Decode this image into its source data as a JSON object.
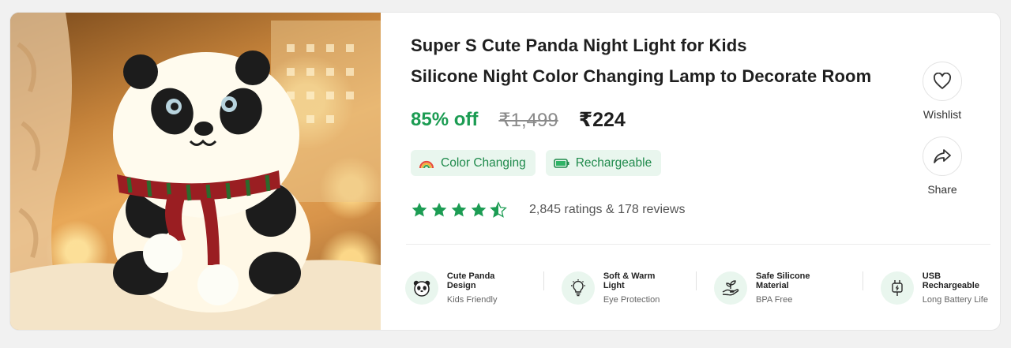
{
  "product": {
    "title_line1": "Super S Cute Panda Night Light for Kids",
    "title_line2": "Silicone Night Color Changing Lamp to Decorate Room",
    "discount": "85% off",
    "mrp": "₹1,499",
    "price": "₹224",
    "rating_value": 4.5,
    "rating_text": "2,845 ratings & 178 reviews"
  },
  "tags": [
    {
      "label": "Color Changing",
      "icon": "rainbow-icon"
    },
    {
      "label": "Rechargeable",
      "icon": "battery-icon"
    }
  ],
  "actions": {
    "wishlist_label": "Wishlist",
    "share_label": "Share"
  },
  "features": [
    {
      "title": "Cute Panda Design",
      "subtitle": "Kids Friendly",
      "icon": "panda-icon"
    },
    {
      "title": "Soft & Warm Light",
      "subtitle": "Eye Protection",
      "icon": "bulb-icon"
    },
    {
      "title": "Safe Silicone Material",
      "subtitle": "BPA Free",
      "icon": "sprout-hand-icon"
    },
    {
      "title": "USB Rechargeable",
      "subtitle": "Long Battery Life",
      "icon": "usb-plug-icon"
    }
  ],
  "colors": {
    "accent_green": "#1c9c53",
    "tag_bg": "#e9f6ee",
    "star_green": "#1c9c53"
  }
}
